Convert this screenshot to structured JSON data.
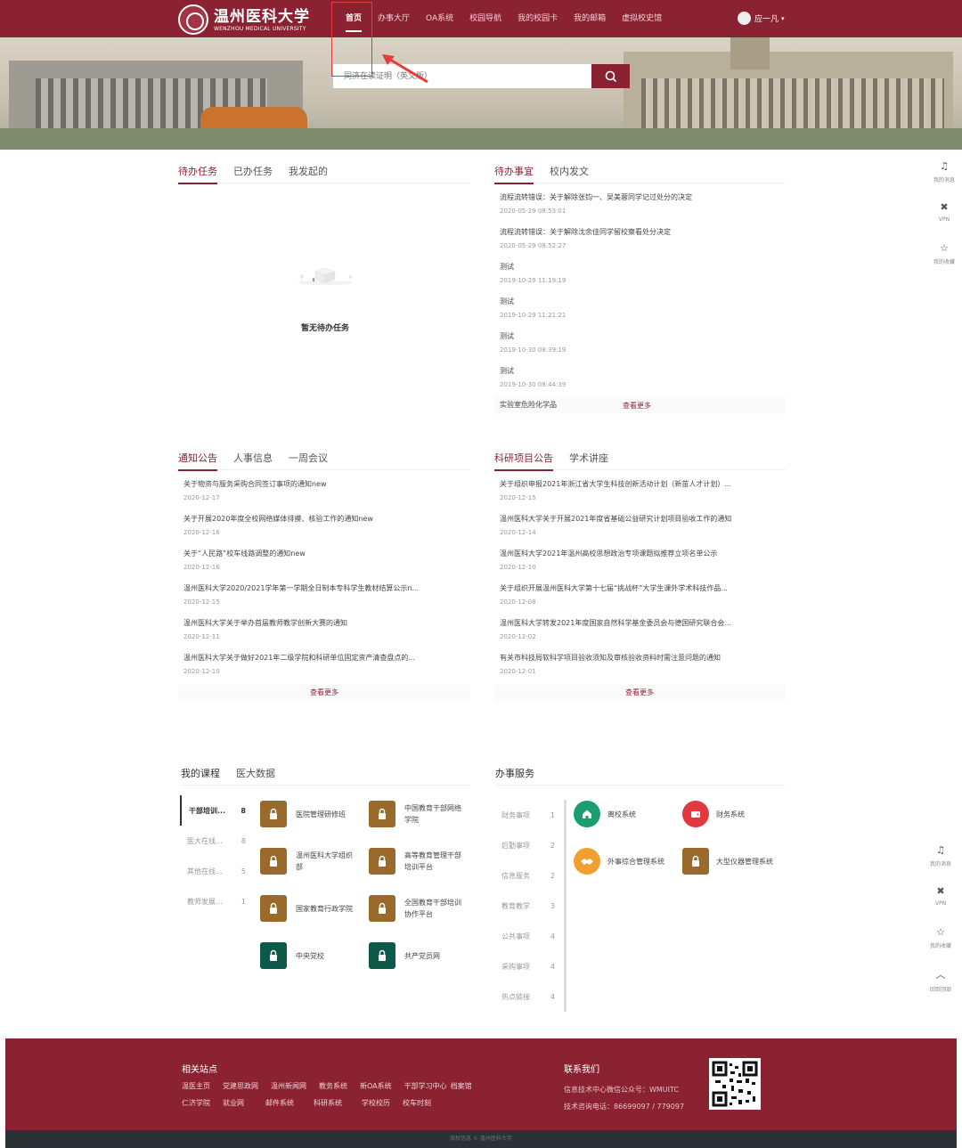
{
  "header": {
    "logo_cn": "温州医科大学",
    "logo_en": "WENZHOU MEDICAL UNIVERSITY",
    "nav": [
      "首页",
      "办事大厅",
      "OA系统",
      "校园导航",
      "我的校园卡",
      "我的邮箱",
      "虚拟校史馆"
    ],
    "user_name": "应一凡",
    "caret": "▾"
  },
  "search": {
    "placeholder": "同济在读证明（英文版）"
  },
  "tasks": {
    "tabs": [
      "待办任务",
      "已办任务",
      "我发起的"
    ],
    "empty_text": "暂无待办任务"
  },
  "todo": {
    "tabs": [
      "待办事宜",
      "校内发文"
    ],
    "items": [
      {
        "title": "流程流转错误：关于解除张钧一、吴美蓉同学记过处分的决定",
        "date": "2020-05-29 08:53:01"
      },
      {
        "title": "流程流转错误：关于解除沈余佳同学留校察看处分决定",
        "date": "2020-05-29 08:52:27"
      },
      {
        "title": "测试",
        "date": "2019-10-29 11:19:19"
      },
      {
        "title": "测试",
        "date": "2019-10-29 11:21:21"
      },
      {
        "title": "测试",
        "date": "2019-10-30 08:39:19"
      },
      {
        "title": "测试",
        "date": "2019-10-30 08:44:39"
      },
      {
        "title": "实验室危险化学品",
        "date": ""
      }
    ],
    "more": "查看更多"
  },
  "notices": {
    "tabs": [
      "通知公告",
      "人事信息",
      "一周会议"
    ],
    "items": [
      {
        "title": "关于物资与服务采购合同签订事项的通知new",
        "date": "2020-12-17"
      },
      {
        "title": "关于开展2020年度全校网络媒体排摸、核验工作的通知new",
        "date": "2020-12-16"
      },
      {
        "title": "关于“人民路”校车线路调整的通知new",
        "date": "2020-12-16"
      },
      {
        "title": "温州医科大学2020/2021学年第一学期全日制本专科学生教材结算公示n...",
        "date": "2020-12-15"
      },
      {
        "title": "温州医科大学关于举办首届教师教学创新大赛的通知",
        "date": "2020-12-11"
      },
      {
        "title": "温州医科大学关于做好2021年二级学院和科研单位固定资产清查盘点的...",
        "date": "2020-12-10"
      }
    ],
    "more": "查看更多"
  },
  "research": {
    "tabs": [
      "科研项目公告",
      "学术讲座"
    ],
    "items": [
      {
        "title": "关于组织申报2021年浙江省大学生科技创新活动计划（新苗人才计划）...",
        "date": "2020-12-15"
      },
      {
        "title": "温州医科大学关于开展2021年度省基础公益研究计划项目验收工作的通知",
        "date": "2020-12-14"
      },
      {
        "title": "温州医科大学2021年温州高校思想政治专项课题拟推荐立项名单公示",
        "date": "2020-12-10"
      },
      {
        "title": "关于组织开展温州医科大学第十七届“挑战杯”大学生课外学术科技作品...",
        "date": "2020-12-08"
      },
      {
        "title": "温州医科大学转发2021年度国家自然科学基金委员会与德国研究联合会...",
        "date": "2020-12-02"
      },
      {
        "title": "有关市科技局软科学项目验收须知及审核验收资料时需注意问题的通知",
        "date": "2020-12-01"
      }
    ],
    "more": "查看更多"
  },
  "courses": {
    "tabs": [
      "我的课程",
      "医大数据"
    ],
    "sidebar": [
      {
        "label": "干部培训...",
        "count": "8"
      },
      {
        "label": "医大在线...",
        "count": "8"
      },
      {
        "label": "其他在线...",
        "count": "5"
      },
      {
        "label": "教师发展...",
        "count": "1"
      }
    ],
    "items": [
      {
        "name": "医院管理研修班",
        "color": "#9a6a2c",
        "icon": "lock-icon"
      },
      {
        "name": "中国教育干部网络学院",
        "color": "#9a6a2c",
        "icon": "lock-icon"
      },
      {
        "name": "温州医科大学组织部",
        "color": "#9a6a2c",
        "icon": "lock-icon"
      },
      {
        "name": "高等教育管理干部培训平台",
        "color": "#9a6a2c",
        "icon": "lock-icon"
      },
      {
        "name": "国家教育行政学院",
        "color": "#9a6a2c",
        "icon": "lock-icon"
      },
      {
        "name": "全国教育干部培训协作平台",
        "color": "#9a6a2c",
        "icon": "lock-icon"
      },
      {
        "name": "中央党校",
        "color": "#0d5a4a",
        "icon": "lock-icon"
      },
      {
        "name": "共产党员网",
        "color": "#0d5a4a",
        "icon": "lock-icon"
      }
    ]
  },
  "services": {
    "tabs": [
      "办事服务"
    ],
    "sidebar": [
      {
        "label": "财务事项",
        "count": "1"
      },
      {
        "label": "后勤事项",
        "count": "2"
      },
      {
        "label": "信息服务",
        "count": "2"
      },
      {
        "label": "教育教学",
        "count": "3"
      },
      {
        "label": "公共事项",
        "count": "4"
      },
      {
        "label": "采购事项",
        "count": "4"
      },
      {
        "label": "热点链接",
        "count": "4"
      }
    ],
    "items": [
      {
        "name": "离校系统",
        "color": "#1a9e6e",
        "icon": "home-icon"
      },
      {
        "name": "财务系统",
        "color": "#e0393e",
        "icon": "wallet-icon"
      },
      {
        "name": "外事综合管理系统",
        "color": "#f0a030",
        "icon": "handshake-icon"
      },
      {
        "name": "大型仪器管理系统",
        "color": "#9a6a2c",
        "icon": "lock-icon"
      }
    ]
  },
  "float_top": [
    {
      "label": "我的消息",
      "icon": "bell-icon"
    },
    {
      "label": "VPN",
      "icon": "vpn-icon"
    },
    {
      "label": "我的收藏",
      "icon": "star-icon"
    }
  ],
  "float_bottom": [
    {
      "label": "我的消息",
      "icon": "bell-icon"
    },
    {
      "label": "VPN",
      "icon": "vpn-icon"
    },
    {
      "label": "我的收藏",
      "icon": "star-icon"
    },
    {
      "label": "回到顶部",
      "icon": "chevron-up-icon"
    }
  ],
  "footer": {
    "sites_title": "相关站点",
    "links_row1": [
      "温医主页",
      "党建思政网",
      "温州新闻网",
      "教务系统",
      "新OA系统",
      "干部学习中心",
      "档案馆"
    ],
    "links_row2": [
      "仁济学院",
      "就业网",
      "邮件系统",
      "科研系统",
      "学校校历",
      "校车时刻"
    ],
    "contact_title": "联系我们",
    "contact_line1": "信息技术中心微信公众号：WMUITC",
    "contact_line2": "技术咨询电话：86699097 / 779097",
    "copyright": "版权信息 © 温州医科大学"
  },
  "colors": {
    "brand": "#8b2232",
    "dark": "#2b3236"
  }
}
